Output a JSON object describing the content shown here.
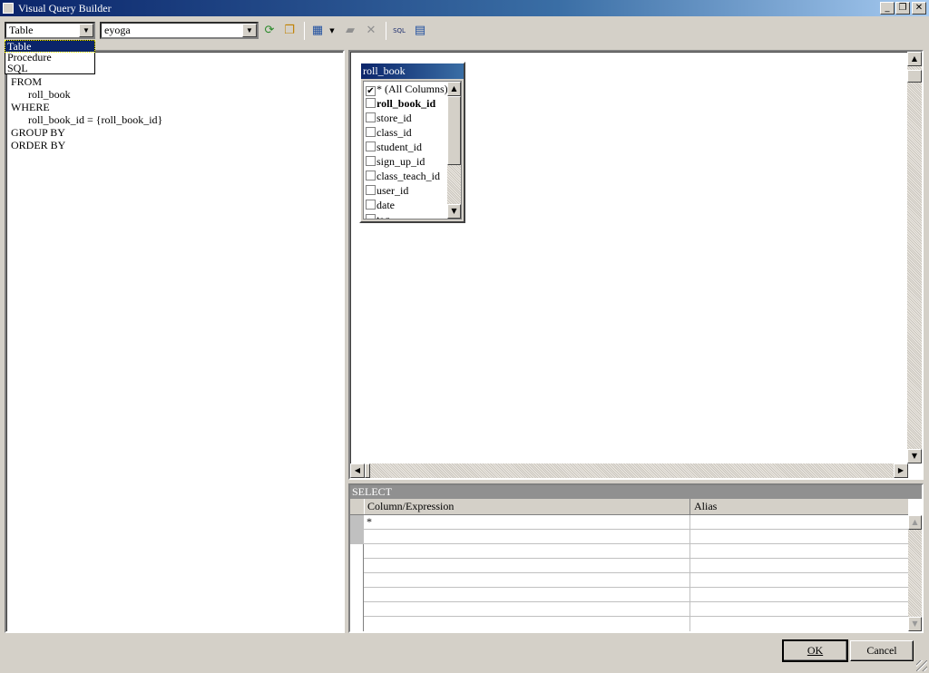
{
  "window": {
    "title": "Visual Query Builder",
    "minimize": "_",
    "restore": "❐",
    "close": "✕"
  },
  "toolbar": {
    "type_combo": {
      "value": "Table",
      "options": [
        "Table",
        "Procedure",
        "SQL"
      ],
      "selected_index": 0
    },
    "database_combo": {
      "value": "eyoga"
    },
    "icons": [
      "refresh-icon",
      "copy-database-icon",
      "add-table-icon",
      "dropdown-arrow-icon",
      "edit-table-icon",
      "delete-icon",
      "sql-icon",
      "grid-view-icon"
    ]
  },
  "sql_tree": [
    "FROM",
    "roll_book",
    "WHERE",
    "roll_book_id = {roll_book_id}",
    "GROUP BY",
    "ORDER BY"
  ],
  "table_box": {
    "title": "roll_book",
    "columns": [
      {
        "name": "* (All Columns)",
        "checked": true,
        "bold": false
      },
      {
        "name": "roll_book_id",
        "checked": false,
        "bold": true
      },
      {
        "name": "store_id",
        "checked": false
      },
      {
        "name": "class_id",
        "checked": false
      },
      {
        "name": "student_id",
        "checked": false
      },
      {
        "name": "sign_up_id",
        "checked": false
      },
      {
        "name": "class_teach_id",
        "checked": false
      },
      {
        "name": "user_id",
        "checked": false
      },
      {
        "name": "date",
        "checked": false
      },
      {
        "name": "tag",
        "checked": false
      }
    ]
  },
  "select_grid": {
    "title": "SELECT",
    "headers": [
      "Column/Expression",
      "Alias"
    ],
    "rows": [
      [
        "*",
        ""
      ],
      [
        "",
        ""
      ],
      [
        "",
        ""
      ],
      [
        "",
        ""
      ],
      [
        "",
        ""
      ],
      [
        "",
        ""
      ],
      [
        "",
        ""
      ],
      [
        "",
        ""
      ]
    ]
  },
  "buttons": {
    "ok": "OK",
    "cancel": "Cancel"
  },
  "colors": {
    "titlebar": "#0a246a",
    "face": "#d4d0c8"
  }
}
